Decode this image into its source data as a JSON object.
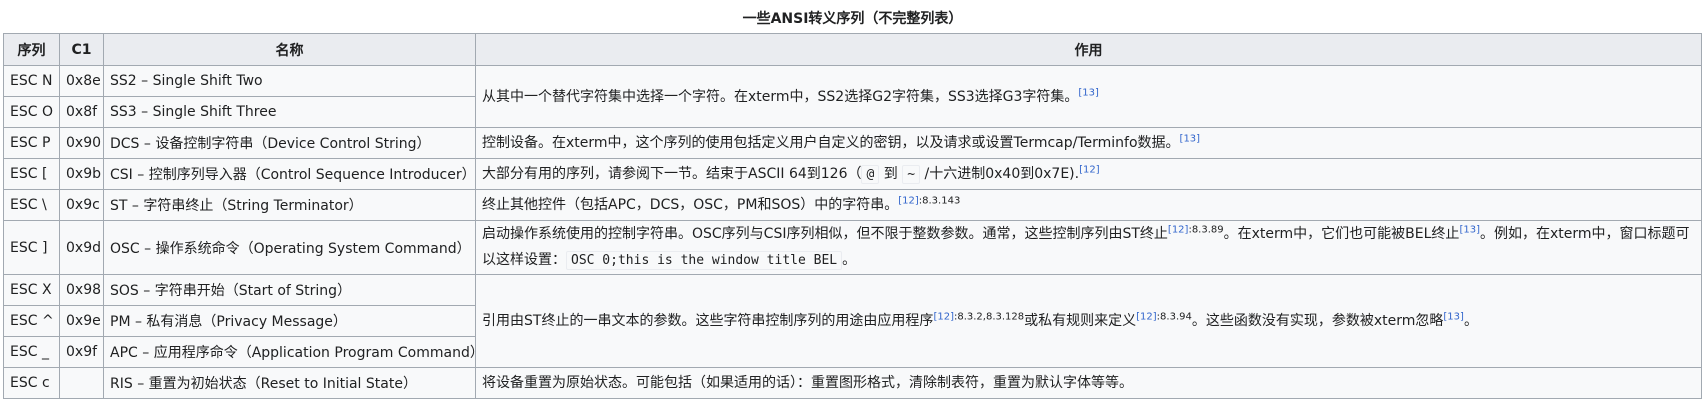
{
  "caption": "一些ANSI转义序列（不完整列表）",
  "headers": {
    "seq": "序列",
    "c1": "C1",
    "name": "名称",
    "use": "作用"
  },
  "rows": [
    {
      "seq": "ESC N",
      "c1": "0x8e",
      "name": "SS2 – Single Shift Two"
    },
    {
      "seq": "ESC O",
      "c1": "0x8f",
      "name": "SS3 – Single Shift Three"
    },
    {
      "seq": "ESC P",
      "c1": "0x90",
      "name": "DCS – 设备控制字符串（Device Control String）"
    },
    {
      "seq": "ESC [",
      "c1": "0x9b",
      "name": "CSI – 控制序列导入器（Control Sequence Introducer）"
    },
    {
      "seq": "ESC \\",
      "c1": "0x9c",
      "name": "ST – 字符串终止（String Terminator）"
    },
    {
      "seq": "ESC ]",
      "c1": "0x9d",
      "name": "OSC – 操作系统命令（Operating System Command）"
    },
    {
      "seq": "ESC X",
      "c1": "0x98",
      "name": "SOS – 字符串开始（Start of String）"
    },
    {
      "seq": "ESC ^",
      "c1": "0x9e",
      "name": "PM – 私有消息（Privacy Message）"
    },
    {
      "seq": "ESC _",
      "c1": "0x9f",
      "name": "APC – 应用程序命令（Application Program Command）"
    },
    {
      "seq": "ESC c",
      "c1": "",
      "name": "RIS – 重置为初始状态（Reset to Initial State）"
    }
  ],
  "desc": {
    "ss": {
      "text": "从其中一个替代字符集中选择一个字符。在xterm中，SS2选择G2字符集，SS3选择G3字符集。",
      "ref": "[13]"
    },
    "dcs": {
      "text": "控制设备。在xterm中，这个序列的使用包括定义用户自定义的密钥，以及请求或设置Termcap/Terminfo数据。",
      "ref": "[13]"
    },
    "csi": {
      "pre": "大部分有用的序列，请参阅下一节。结束于ASCII 64到126（",
      "c1": "@",
      "mid": " 到 ",
      "c2": "~",
      "post": " /十六进制0x40到0x7E).",
      "ref": "[12]"
    },
    "st": {
      "text": "终止其他控件（包括APC，DCS，OSC，PM和SOS）中的字符串。",
      "ref": "[12]",
      "pg": ":8.3.143"
    },
    "osc": {
      "t1": "启动操作系统使用的控制字符串。OSC序列与CSI序列相似，但不限于整数参数。通常，这些控制序列由ST终止",
      "ref1": "[12]",
      "pg1": ":8.3.89",
      "t2": "。在xterm中，它们也可能被BEL终止",
      "ref2": "[13]",
      "t3": "。例如，在xterm中，窗口标题可以这样设置：",
      "code": "OSC 0;this is the window title BEL",
      "t4": "。"
    },
    "sos": {
      "t1": "引用由ST终止的一串文本的参数。这些字符串控制序列的用途由应用程序",
      "ref1": "[12]",
      "pg1": ":8.3.2,8.3.128",
      "t2": "或私有规则来定义",
      "ref2": "[12]",
      "pg2": ":8.3.94",
      "t3": "。这些函数没有实现，参数被xterm忽略",
      "ref3": "[13]",
      "t4": "。"
    },
    "ris": {
      "text": "将设备重置为原始状态。可能包括（如果适用的话）：重置图形格式，清除制表符，重置为默认字体等等。"
    }
  }
}
